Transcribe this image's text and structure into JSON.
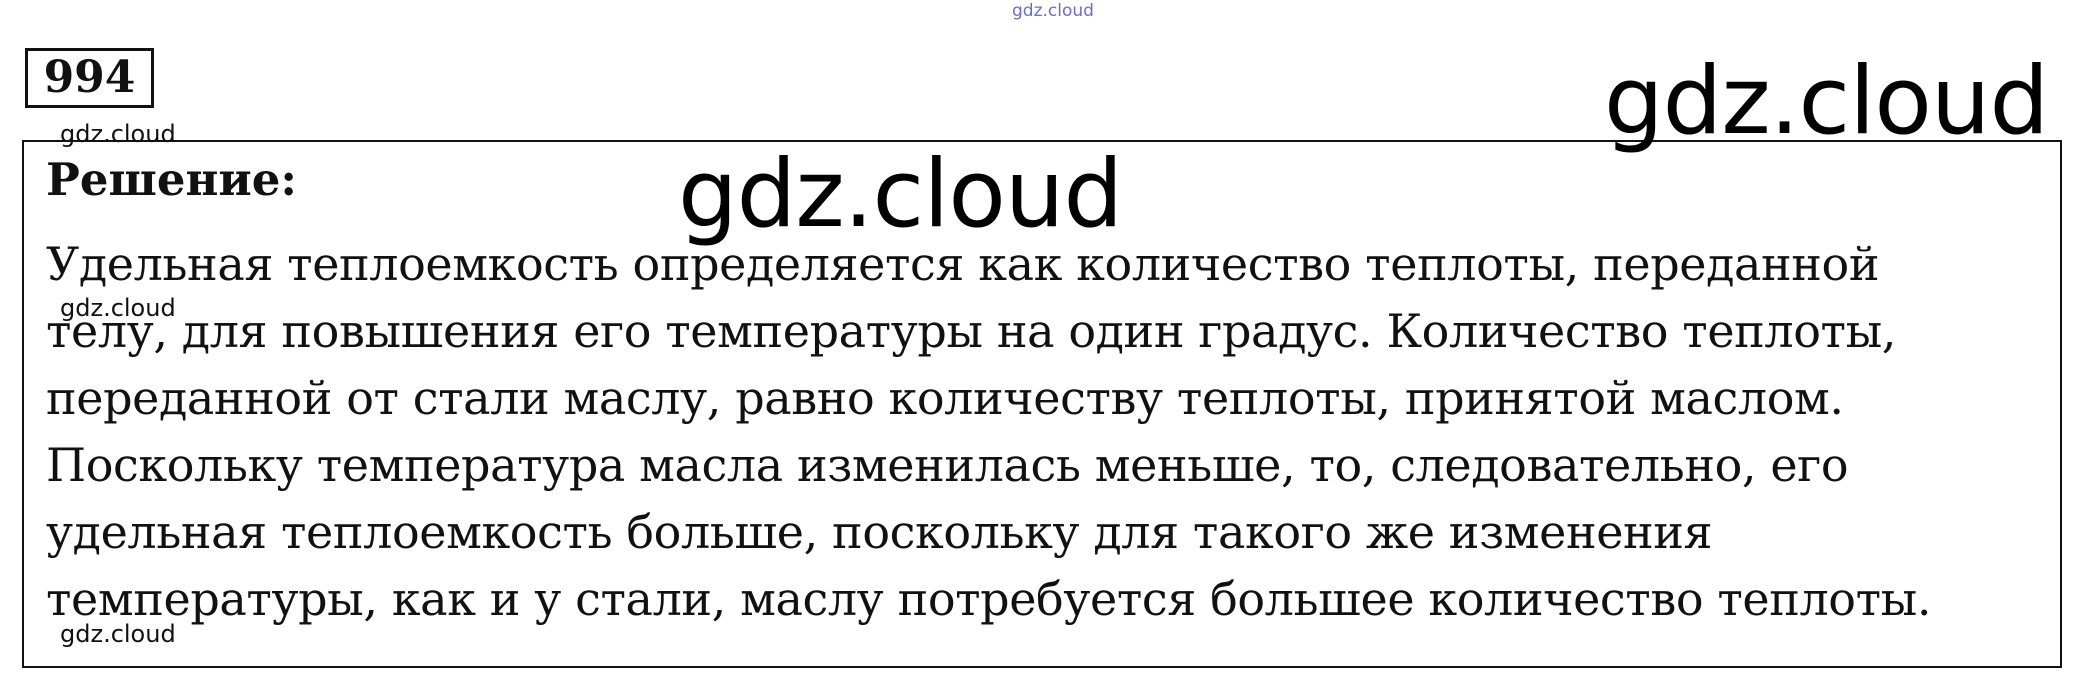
{
  "watermarks": {
    "top": "gdz.cloud",
    "small": [
      "gdz.cloud",
      "gdz.cloud",
      "gdz.cloud"
    ],
    "large": [
      "gdz.cloud",
      "gdz.cloud"
    ]
  },
  "task": {
    "number": "994"
  },
  "solution": {
    "title": "Решение:",
    "lines": [
      "Удельная теплоемкость определяется как количество теплоты, переданной",
      "телу, для повышения его температуры на один градус. Количество теплоты,",
      "переданной от стали маслу, равно количеству теплоты, принятой маслом.",
      "Поскольку температура масла изменилась меньше, то, следовательно, его",
      "удельная теплоемкость больше, поскольку для такого же изменения",
      "температуры, как и у стали, маслу потребуется большее количество теплоты."
    ]
  }
}
